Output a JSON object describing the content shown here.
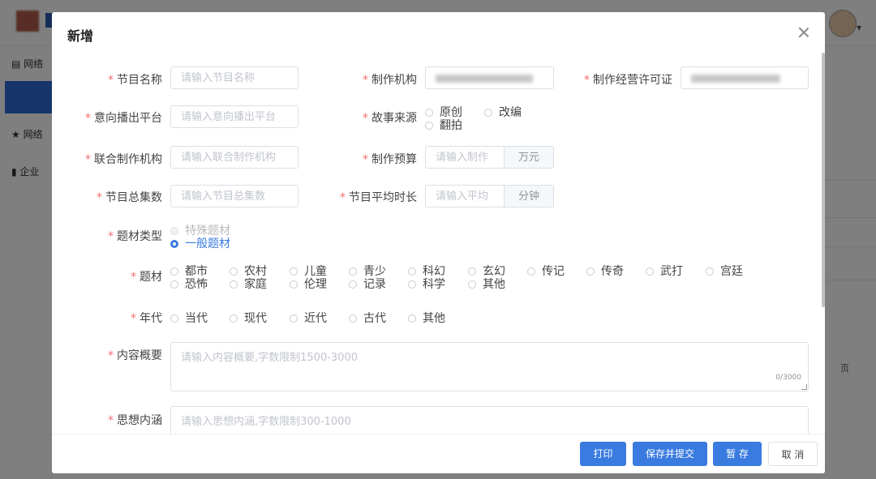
{
  "modal": {
    "title": "新增",
    "fields": {
      "program_name": {
        "label": "节目名称",
        "placeholder": "请输入节目名称"
      },
      "producer": {
        "label": "制作机构"
      },
      "license": {
        "label": "制作经营许可证"
      },
      "platform": {
        "label": "意向播出平台",
        "placeholder": "请输入意向播出平台"
      },
      "story_source": {
        "label": "故事来源",
        "options": [
          "原创",
          "改编",
          "翻拍"
        ]
      },
      "co_producer": {
        "label": "联合制作机构",
        "placeholder": "请输入联合制作机构"
      },
      "budget": {
        "label": "制作预算",
        "placeholder": "请输入制作",
        "unit": "万元"
      },
      "episodes": {
        "label": "节目总集数",
        "placeholder": "请输入节目总集数"
      },
      "avg_length": {
        "label": "节目平均时长",
        "placeholder": "请输入平均",
        "unit": "分钟"
      },
      "theme_type": {
        "label": "题材类型",
        "options": [
          "特殊题材",
          "一般题材"
        ],
        "selected": "一般题材",
        "disabled": "特殊题材"
      },
      "theme": {
        "label": "题材",
        "options": [
          "都市",
          "农村",
          "儿童",
          "青少",
          "科幻",
          "玄幻",
          "传记",
          "传奇",
          "武打",
          "宫廷",
          "恐怖",
          "家庭",
          "伦理",
          "记录",
          "科学",
          "其他"
        ]
      },
      "era": {
        "label": "年代",
        "options": [
          "当代",
          "现代",
          "近代",
          "古代",
          "其他"
        ]
      },
      "summary": {
        "label": "内容概要",
        "placeholder": "请输入内容概要,字数限制1500-3000",
        "counter": "0/3000"
      },
      "connotation": {
        "label": "思想内涵",
        "placeholder": "请输入思想内涵,字数限制300-1000"
      }
    },
    "buttons": {
      "print": "打印",
      "save_submit": "保存并提交",
      "stash": "暂 存",
      "cancel": "取 消"
    }
  },
  "background": {
    "nav": [
      "网络",
      "网络",
      "企业"
    ],
    "page_suffix": "页"
  },
  "colors": {
    "primary": "#3a7be0",
    "required": "#f56c6c"
  }
}
